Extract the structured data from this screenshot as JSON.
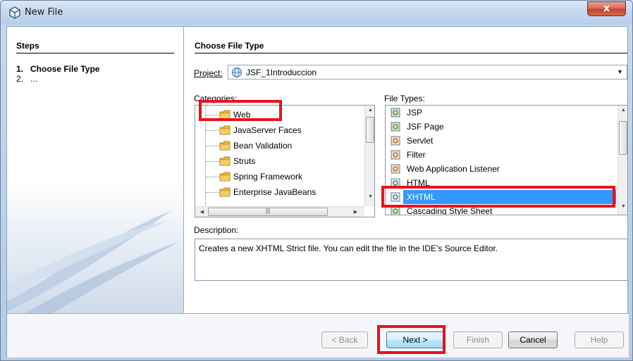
{
  "window": {
    "title": "New File",
    "close_glyph": "x"
  },
  "steps": {
    "title": "Steps",
    "items": [
      {
        "num": "1.",
        "label": "Choose File Type"
      },
      {
        "num": "2.",
        "label": "..."
      }
    ]
  },
  "main": {
    "section_title": "Choose File Type",
    "project_label": "Project:",
    "project_value": "JSF_1Introduccion",
    "categories_label": "Categories:",
    "filetypes_label": "File Types:",
    "categories": [
      "Web",
      "JavaServer Faces",
      "Bean Validation",
      "Struts",
      "Spring Framework",
      "Enterprise JavaBeans"
    ],
    "file_types": [
      "JSP",
      "JSF Page",
      "Servlet",
      "Filter",
      "Web Application Listener",
      "HTML",
      "XHTML",
      "Cascading Style Sheet"
    ],
    "selected_category": "Web",
    "selected_file_type": "XHTML",
    "description_label": "Description:",
    "description_text": "Creates a new XHTML Strict file. You can edit the file in the IDE's Source Editor."
  },
  "buttons": {
    "back": "< Back",
    "next": "Next >",
    "finish": "Finish",
    "cancel": "Cancel",
    "help": "Help"
  },
  "colors": {
    "selection": "#3399ff",
    "highlight_box": "#e8121b",
    "folder": "#e8b73c"
  },
  "icons": {
    "title": "netbeans-cube-icon",
    "project": "web-project-globe-icon",
    "category": "folder-icon",
    "file_type": "file-template-icon"
  }
}
